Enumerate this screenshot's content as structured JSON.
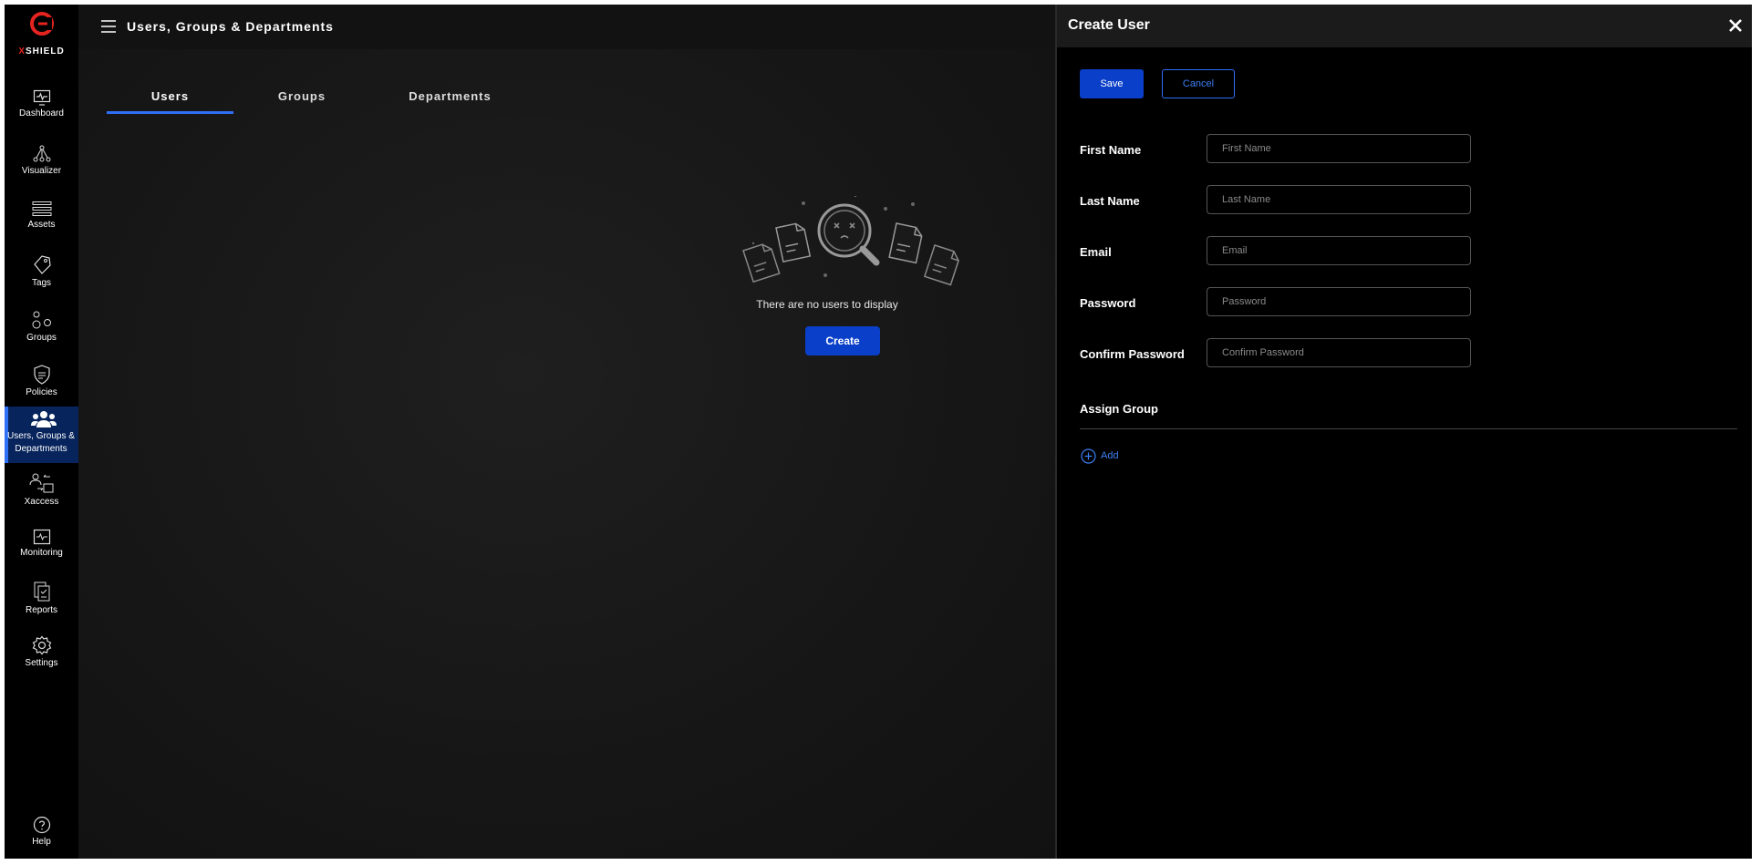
{
  "brand": {
    "logo_x": "X",
    "logo_rest": "SHIELD",
    "accent_red": "#e52420"
  },
  "colors": {
    "accent_blue": "#2f6ff5",
    "primary_button": "#0a3fc9",
    "active_nav_bg": "#07245c"
  },
  "sidebar": {
    "items": [
      {
        "label": "Dashboard",
        "icon": "dashboard-icon"
      },
      {
        "label": "Visualizer",
        "icon": "visualizer-icon"
      },
      {
        "label": "Assets",
        "icon": "assets-icon"
      },
      {
        "label": "Tags",
        "icon": "tag-icon"
      },
      {
        "label": "Groups",
        "icon": "groups-icon"
      },
      {
        "label": "Policies",
        "icon": "shield-icon"
      },
      {
        "label": "Users, Groups & Departments",
        "icon": "users-icon",
        "active": true
      },
      {
        "label": "Xaccess",
        "icon": "xaccess-icon"
      },
      {
        "label": "Monitoring",
        "icon": "monitoring-icon"
      },
      {
        "label": "Reports",
        "icon": "reports-icon"
      },
      {
        "label": "Settings",
        "icon": "gear-icon"
      }
    ],
    "help_label": "Help"
  },
  "header": {
    "title": "Users, Groups & Departments"
  },
  "main": {
    "tabs": [
      {
        "label": "Users",
        "active": true
      },
      {
        "label": "Groups"
      },
      {
        "label": "Departments"
      }
    ],
    "empty_message": "There are no users to display",
    "create_label": "Create"
  },
  "drawer": {
    "title": "Create User",
    "save_label": "Save",
    "cancel_label": "Cancel",
    "fields": [
      {
        "label": "First Name",
        "placeholder": "First Name",
        "value": ""
      },
      {
        "label": "Last Name",
        "placeholder": "Last Name",
        "value": ""
      },
      {
        "label": "Email",
        "placeholder": "Email",
        "value": ""
      },
      {
        "label": "Password",
        "placeholder": "Password",
        "value": ""
      },
      {
        "label": "Confirm Password",
        "placeholder": "Confirm Password",
        "value": ""
      }
    ],
    "assign_group_label": "Assign Group",
    "add_label": "Add"
  }
}
